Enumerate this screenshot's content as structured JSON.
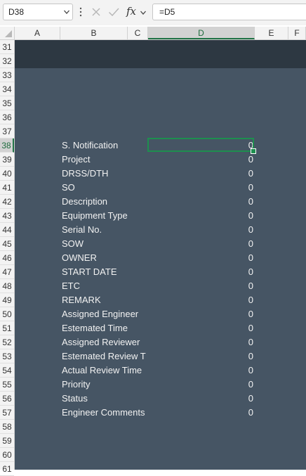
{
  "formula_bar": {
    "name_box": "D38",
    "formula": "=D5",
    "fx_label": "fx"
  },
  "columns": [
    "A",
    "B",
    "C",
    "D",
    "E",
    "F"
  ],
  "selected_column": "D",
  "rows": [
    "31",
    "32",
    "33",
    "34",
    "35",
    "36",
    "37",
    "38",
    "39",
    "40",
    "41",
    "42",
    "43",
    "44",
    "45",
    "46",
    "47",
    "48",
    "49",
    "50",
    "51",
    "52",
    "53",
    "54",
    "55",
    "56",
    "57",
    "58",
    "59",
    "60",
    "61"
  ],
  "selected_row": "38",
  "fields": [
    {
      "label": "S. Notification",
      "value": "0"
    },
    {
      "label": "Project",
      "value": "0"
    },
    {
      "label": "DRSS/DTH",
      "value": "0"
    },
    {
      "label": "SO",
      "value": "0"
    },
    {
      "label": "Description",
      "value": "0"
    },
    {
      "label": "Equipment Type",
      "value": "0"
    },
    {
      "label": "Serial No.",
      "value": "0"
    },
    {
      "label": "SOW",
      "value": "0"
    },
    {
      "label": "OWNER",
      "value": "0"
    },
    {
      "label": "START DATE",
      "value": "0"
    },
    {
      "label": "ETC",
      "value": "0"
    },
    {
      "label": "REMARK",
      "value": "0"
    },
    {
      "label": "Assigned Engineer",
      "value": "0"
    },
    {
      "label": "Estemated Time",
      "value": "0"
    },
    {
      "label": "Assigned Reviewer",
      "value": "0"
    },
    {
      "label": "Estemated Review T",
      "value": "0"
    },
    {
      "label": "Actual Review Time",
      "value": "0"
    },
    {
      "label": "Priority",
      "value": "0"
    },
    {
      "label": "Status",
      "value": "0"
    },
    {
      "label": "Engineer Comments",
      "value": "0"
    }
  ],
  "colors": {
    "sheet_bg": "#465564",
    "header_band": "#2d3842",
    "selection": "#217346"
  }
}
